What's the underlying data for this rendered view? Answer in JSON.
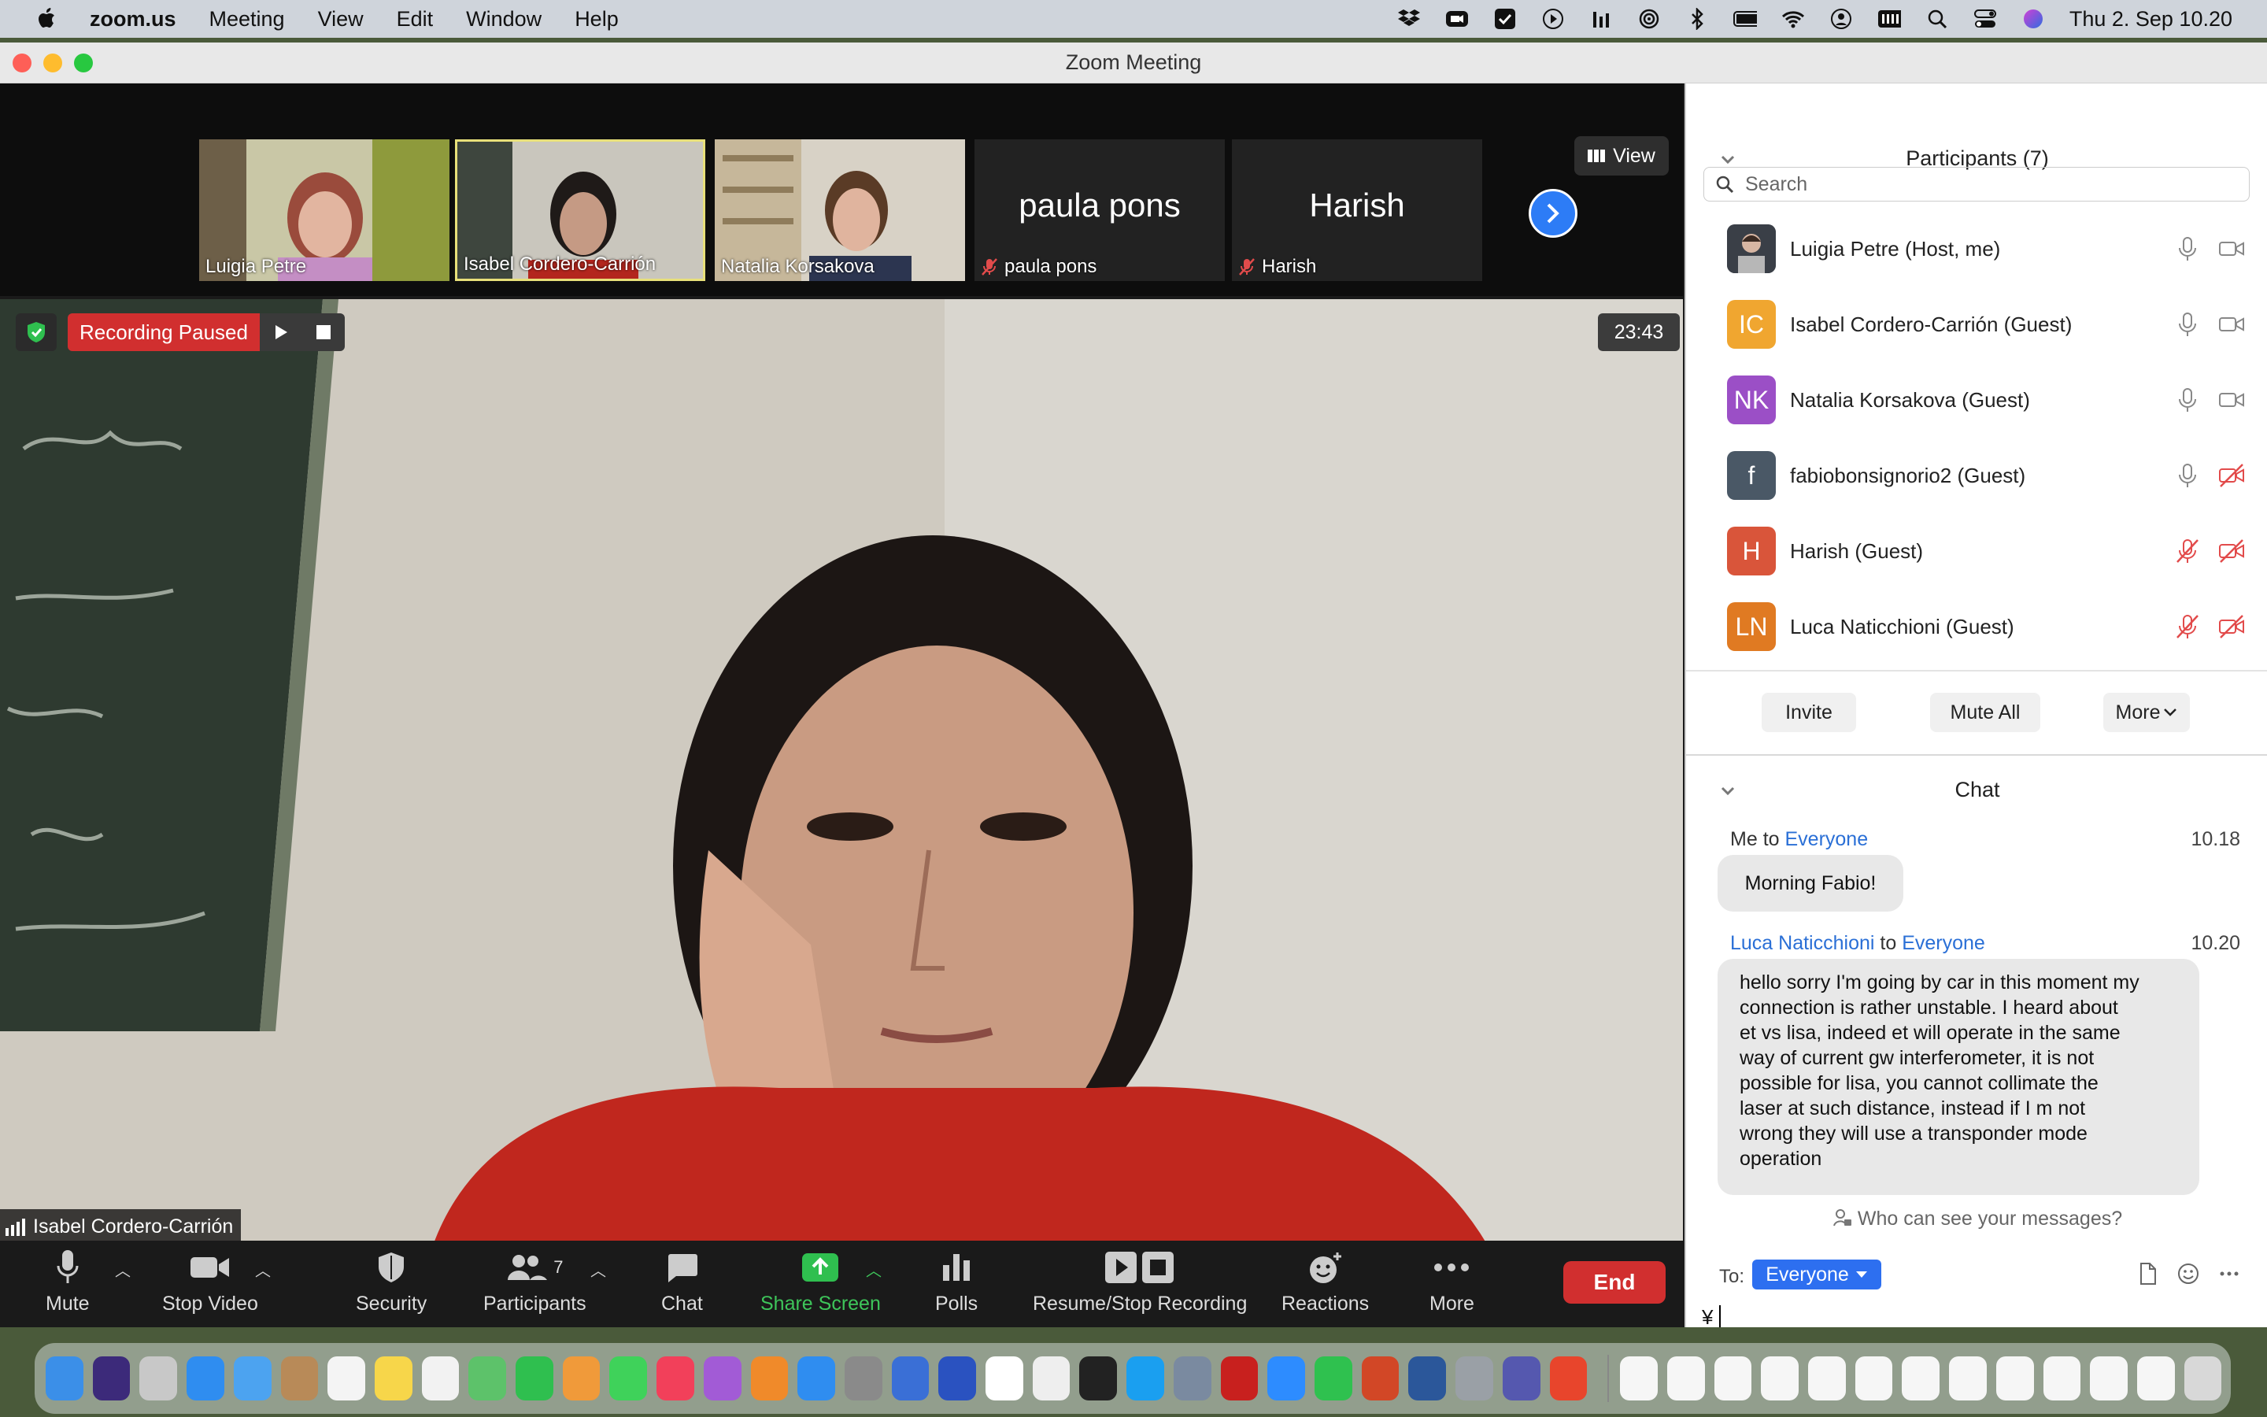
{
  "menubar": {
    "app": "zoom.us",
    "items": [
      "Meeting",
      "View",
      "Edit",
      "Window",
      "Help"
    ],
    "clock": "Thu 2. Sep  10.20"
  },
  "window": {
    "title": "Zoom Meeting"
  },
  "tiles": [
    {
      "name": "Luigia Petre",
      "muted": false,
      "video": true
    },
    {
      "name": "Isabel Cordero-Carrión",
      "muted": false,
      "video": true,
      "active": true
    },
    {
      "name": "Natalia Korsakova",
      "muted": false,
      "video": true
    },
    {
      "name": "paula pons",
      "display": "paula pons",
      "muted": true,
      "video": false
    },
    {
      "name": "Harish",
      "display": "Harish",
      "muted": true,
      "video": false
    }
  ],
  "view_button": "View",
  "recording": {
    "status": "Recording Paused"
  },
  "timer": "23:43",
  "speaker": "Isabel Cordero-Carrión",
  "toolbar": {
    "mute": "Mute",
    "stop_video": "Stop Video",
    "security": "Security",
    "participants": "Participants",
    "participants_count": "7",
    "chat": "Chat",
    "share_screen": "Share Screen",
    "polls": "Polls",
    "resume_stop_recording": "Resume/Stop Recording",
    "reactions": "Reactions",
    "more": "More",
    "end": "End"
  },
  "participants_panel": {
    "title": "Participants (7)",
    "search_placeholder": "Search",
    "list": [
      {
        "name": "Luigia Petre (Host, me)",
        "avatar": "",
        "avatar_color": "#4a4f57",
        "mic_muted": false,
        "video_off": false
      },
      {
        "name": "Isabel Cordero-Carrión (Guest)",
        "avatar": "IC",
        "avatar_color": "#f0a630",
        "mic_muted": false,
        "video_off": false
      },
      {
        "name": "Natalia Korsakova (Guest)",
        "avatar": "NK",
        "avatar_color": "#9b4fc6",
        "mic_muted": false,
        "video_off": false
      },
      {
        "name": "fabiobonsignorio2 (Guest)",
        "avatar": "f",
        "avatar_color": "#4a5866",
        "mic_muted": false,
        "video_off": true
      },
      {
        "name": "Harish (Guest)",
        "avatar": "H",
        "avatar_color": "#d9553a",
        "mic_muted": true,
        "video_off": true
      },
      {
        "name": "Luca Naticchioni (Guest)",
        "avatar": "LN",
        "avatar_color": "#e07a22",
        "mic_muted": true,
        "video_off": true
      }
    ],
    "invite": "Invite",
    "mute_all": "Mute All",
    "more": "More"
  },
  "chat_panel": {
    "title": "Chat",
    "messages": [
      {
        "from": "Me",
        "to_word": "to",
        "to": "Everyone",
        "time": "10.18",
        "text": "Morning Fabio!"
      },
      {
        "from": "Luca Naticchioni",
        "to_word": "to",
        "to": "Everyone",
        "time": "10.20",
        "lines": [
          "hello sorry I'm going by car in this moment my",
          "connection is rather unstable. I heard about",
          "et vs lisa, indeed et will operate in the same",
          "way of current gw interferometer, it is not",
          "possible for lisa, you cannot collimate the",
          "laser at such distance, instead if I m not",
          "wrong they will use a transponder mode",
          "operation"
        ]
      }
    ],
    "who_can_see": "Who can see your messages?",
    "to_label": "To:",
    "to_value": "Everyone",
    "input_value": "¥"
  }
}
